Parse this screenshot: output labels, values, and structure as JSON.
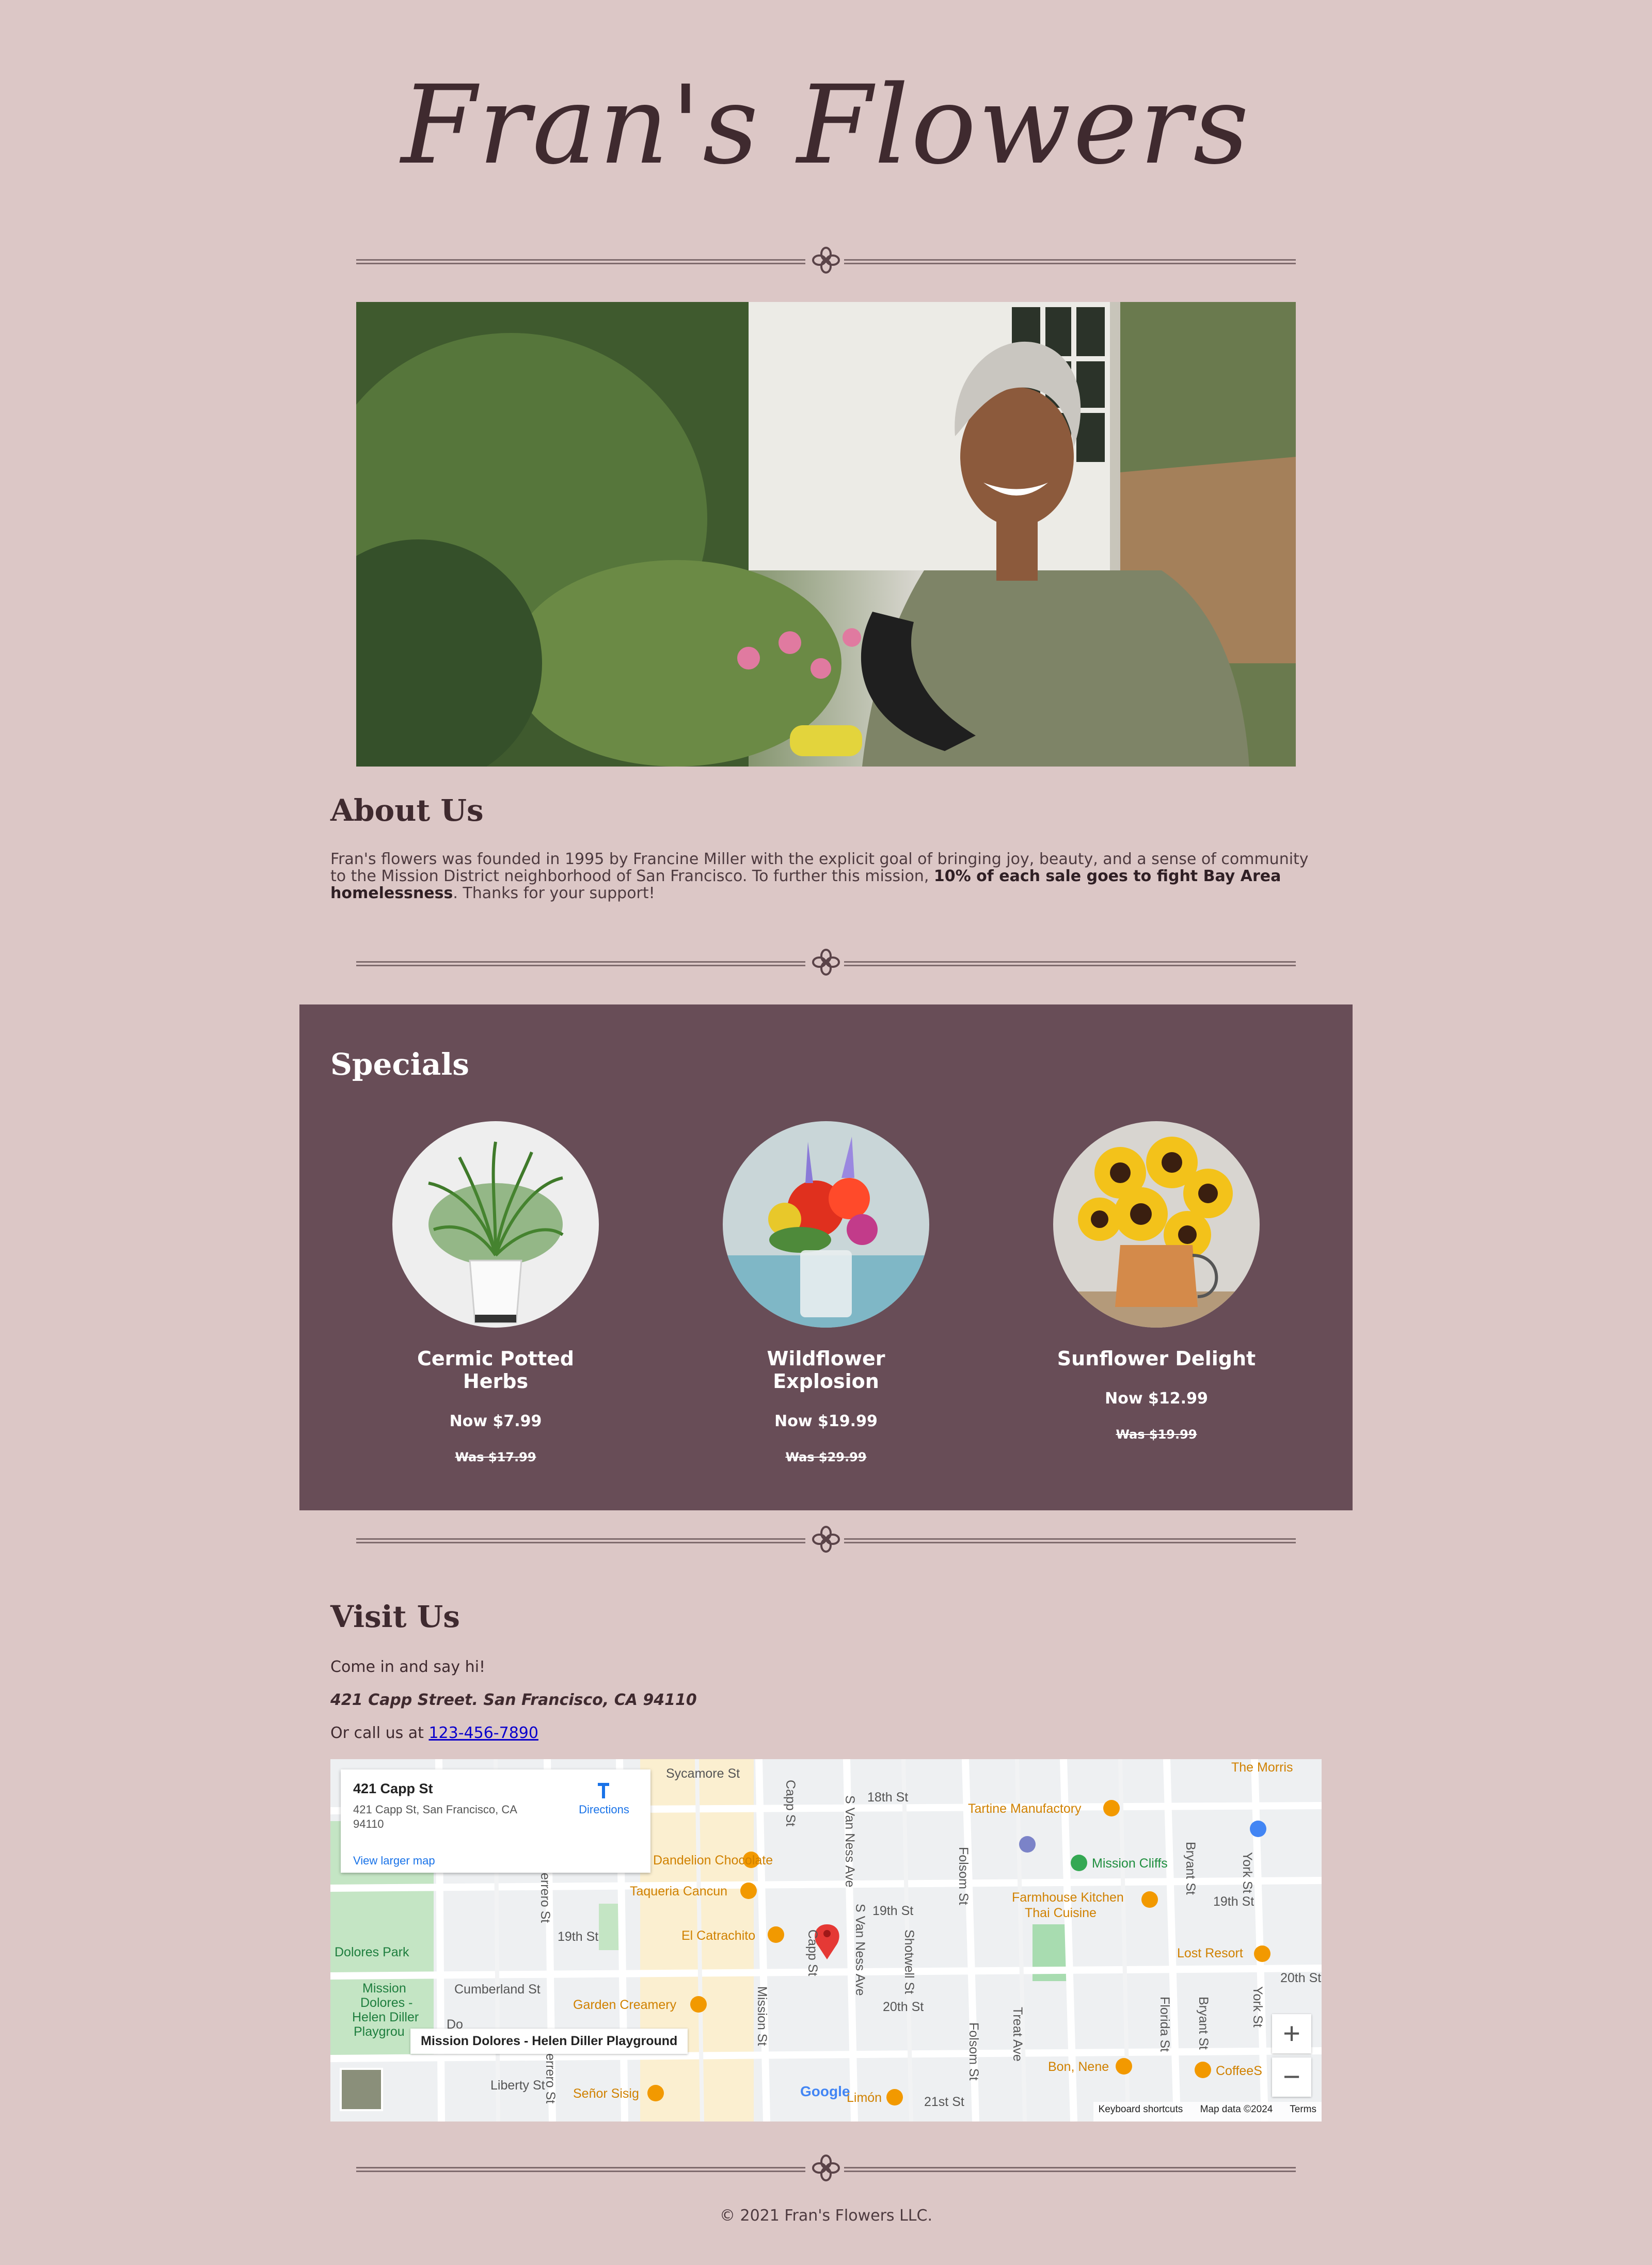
{
  "site": {
    "title": "Fran's Flowers"
  },
  "hero": {
    "alt": "Smiling florist kneeling among flowering plants"
  },
  "about": {
    "heading": "About Us",
    "text_before": "Fran's flowers was founded in 1995 by Francine Miller with the explicit goal of bringing joy, beauty, and a sense of community to the Mission District neighborhood of San Francisco. To further this mission, ",
    "text_bold": "10% of each sale goes to fight Bay Area homelessness",
    "text_after": ". Thanks for your support!"
  },
  "specials": {
    "heading": "Specials",
    "items": [
      {
        "name": "Cermic Potted Herbs",
        "now": "Now $7.99",
        "was": "Was $17.99"
      },
      {
        "name": "Wildflower Explosion",
        "now": "Now $19.99",
        "was": "Was $29.99"
      },
      {
        "name": "Sunflower Delight",
        "now": "Now $12.99",
        "was": "Was $19.99"
      }
    ]
  },
  "visit": {
    "heading": "Visit Us",
    "greeting": "Come in and say hi!",
    "address": "421 Capp Street. San Francisco, CA 94110",
    "call_prefix": "Or call us at ",
    "phone": "123-456-7890"
  },
  "map": {
    "place_title": "421 Capp St",
    "place_address": "421 Capp St, San Francisco, CA 94110",
    "directions": "Directions",
    "larger_map": "View larger map",
    "popup": "Mission Dolores - Helen Diller Playground",
    "zoom_in": "+",
    "zoom_out": "−",
    "google": "Google",
    "shortcuts": "Keyboard shortcuts",
    "map_data": "Map data ©2024",
    "terms": "Terms",
    "streets": {
      "sycamore": "Sycamore St",
      "s18": "18th St",
      "s19": "19th St",
      "s19b": "19th St",
      "s19c": "19th St",
      "s20": "20th St",
      "s20b": "20th St",
      "s21": "21st St",
      "liberty": "Liberty St",
      "cumberland": "Cumberland St",
      "capp": "Capp St",
      "capp2": "Capp St",
      "svanness": "S Van Ness Ave",
      "svanness2": "S Van Ness Ave",
      "shotwell": "Shotwell St",
      "folsom": "Folsom St",
      "folsom2": "Folsom St",
      "treat": "Treat Ave",
      "bryant": "Bryant St",
      "bryant2": "Bryant St",
      "york": "York St",
      "york2": "York St",
      "florida": "Florida St",
      "mission": "Mission St",
      "guerrero": "errero St",
      "guerrero2": "errero St",
      "dolores": "Do"
    },
    "places": {
      "morris": "The Morris",
      "tartine": "Tartine Manufactory",
      "dandelion": "Dandelion Chocolate",
      "taqueria": "Taqueria Cancun",
      "catrachito": "El Catrachito",
      "cliffs": "Mission Cliffs",
      "farmhouse1": "Farmhouse Kitchen",
      "farmhouse2": "Thai Cuisine",
      "lostresort": "Lost Resort",
      "garden": "Garden Creamery",
      "park": "Dolores Park",
      "playground1": "Mission",
      "playground2": "Dolores -",
      "playground3": "Helen Diller",
      "playground4": "Playgrou",
      "bonnene": "Bon, Nene",
      "coffee": "CoffeeS",
      "senor": "Señor Sisig",
      "limon": "Limón"
    }
  },
  "footer": {
    "copyright": "© 2021 Fran's Flowers LLC."
  },
  "colors": {
    "background": "#dcc7c6",
    "specials_bg": "#684d57",
    "text": "#3f2a2f",
    "link": "#0a00cc"
  }
}
